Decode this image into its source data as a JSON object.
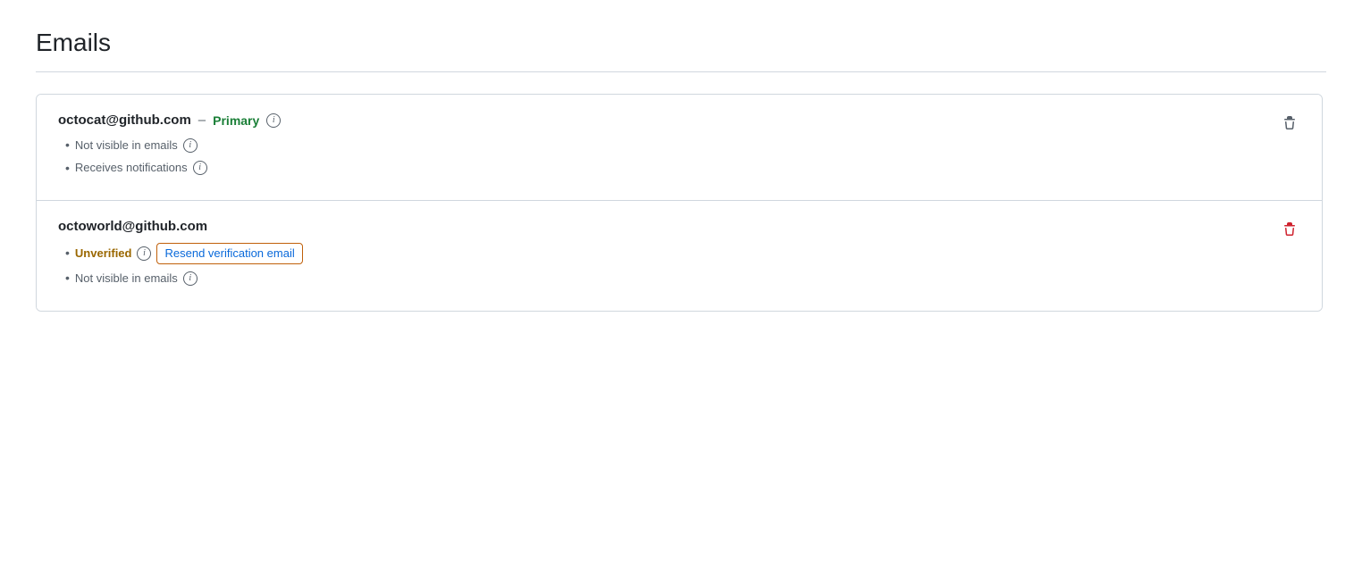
{
  "page": {
    "title": "Emails"
  },
  "emails": [
    {
      "address": "octocat@github.com",
      "is_primary": true,
      "primary_label": "Primary",
      "separator": "–",
      "details": [
        {
          "text": "Not visible in emails",
          "has_info": true
        },
        {
          "text": "Receives notifications",
          "has_info": true
        }
      ],
      "delete_danger": false
    },
    {
      "address": "octoworld@github.com",
      "is_primary": false,
      "details": [
        {
          "text": "Unverified",
          "is_unverified": true,
          "has_resend": true,
          "resend_label": "Resend verification email",
          "has_info": true
        },
        {
          "text": "Not visible in emails",
          "has_info": true
        }
      ],
      "delete_danger": true
    }
  ]
}
